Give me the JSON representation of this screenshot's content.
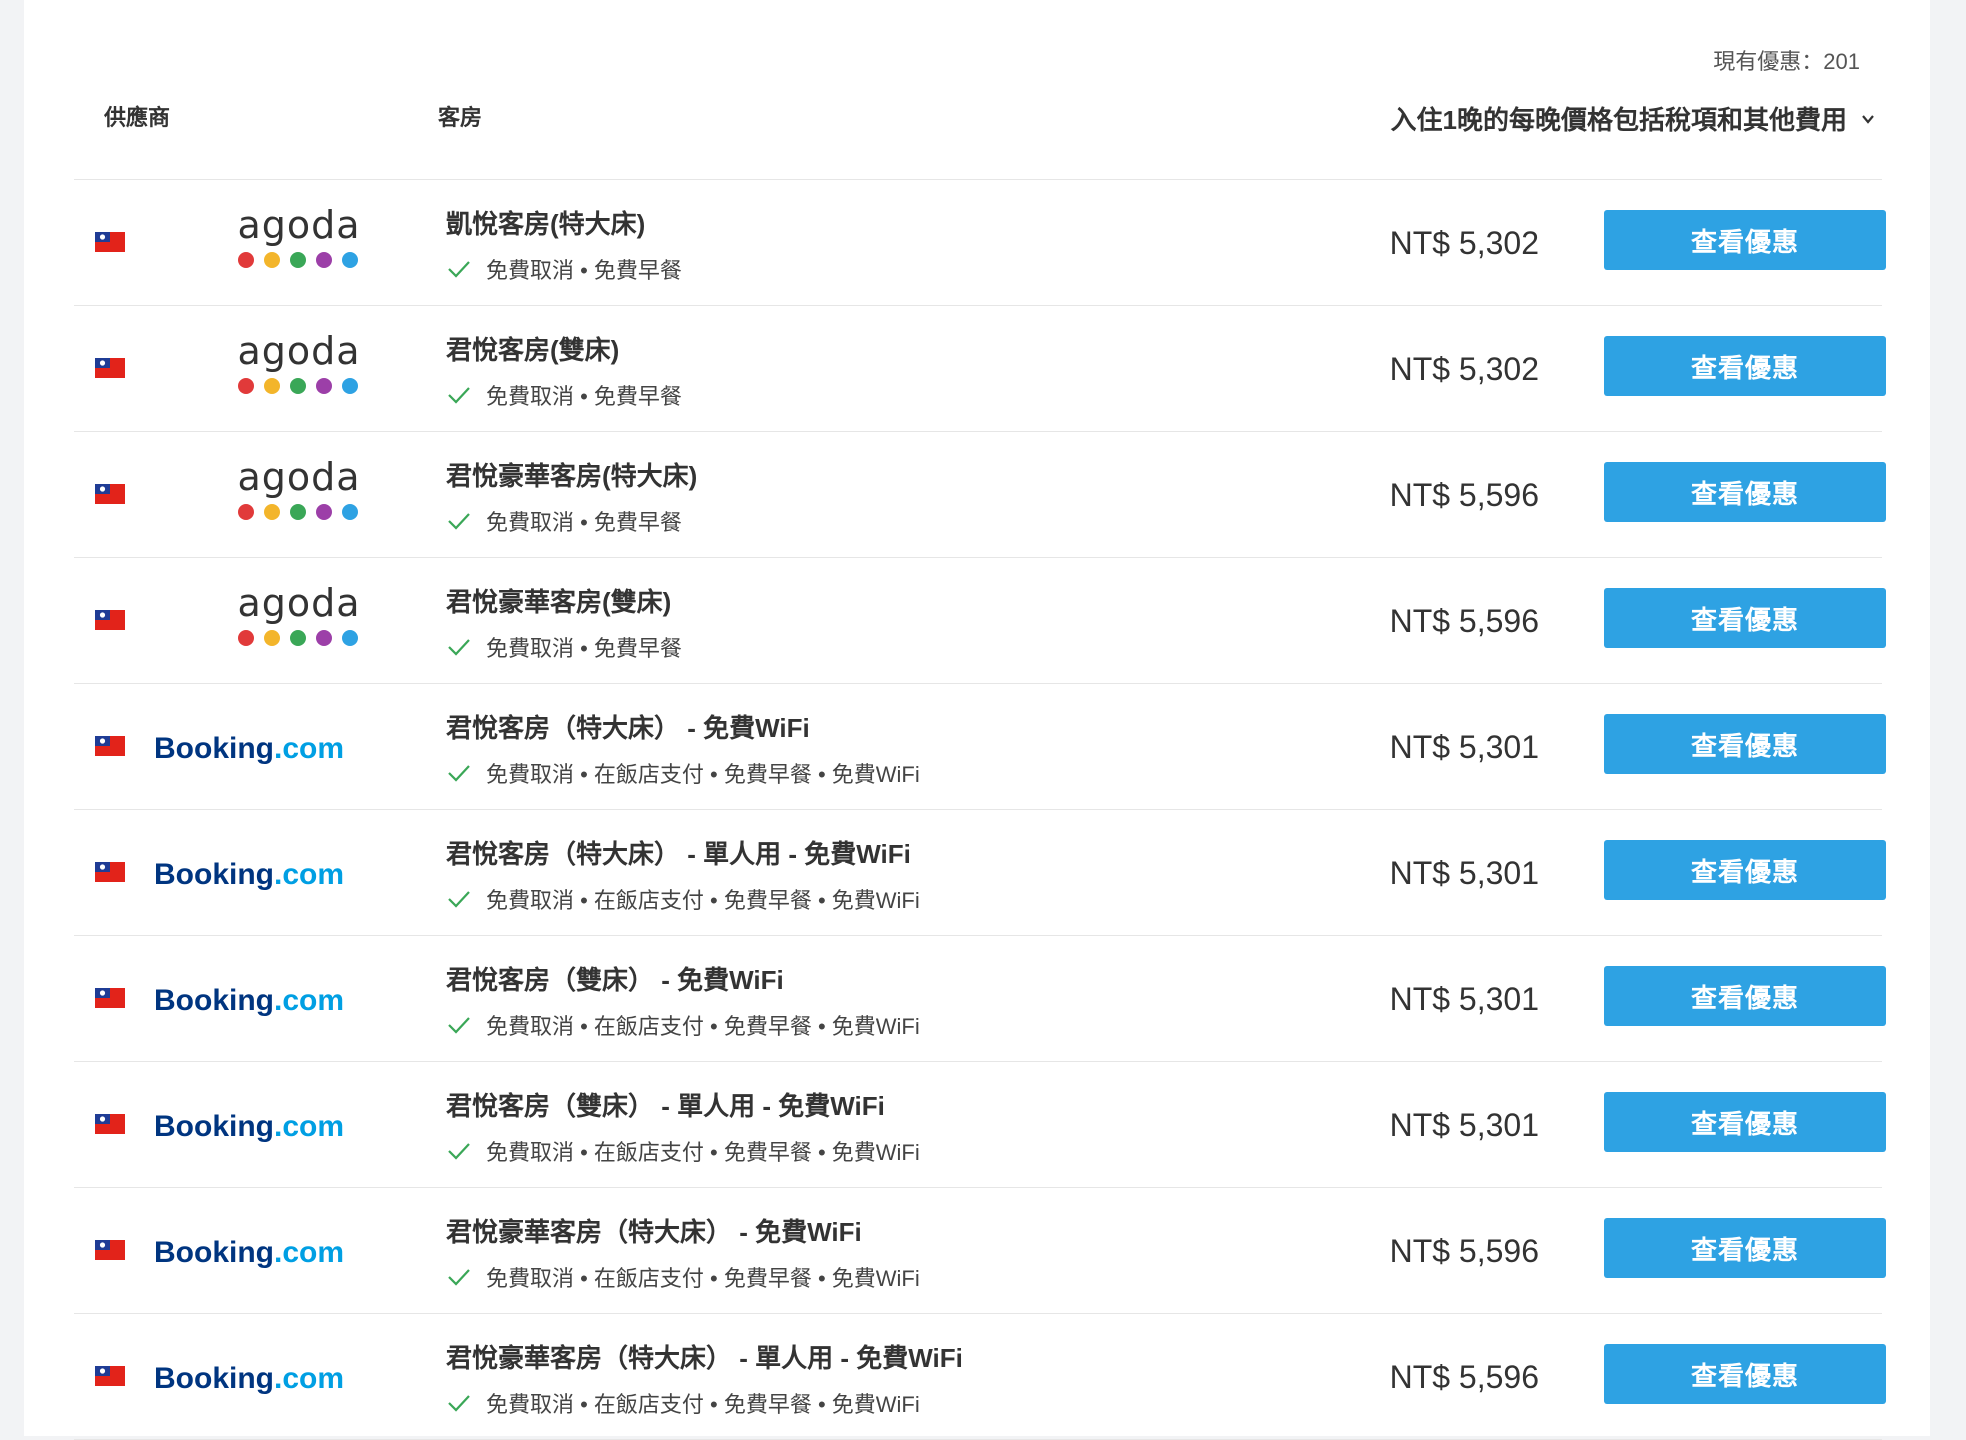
{
  "offers_count_label": "現有優惠：201",
  "headers": {
    "provider": "供應商",
    "room": "客房",
    "price": "入住1晚的每晚價格包括稅項和其他費用"
  },
  "colors": {
    "button": "#2ea2e3",
    "check": "#3aa757",
    "booking_dark": "#003580",
    "booking_light": "#009fe3",
    "agoda_dots": [
      "#e13a3a",
      "#f3b52b",
      "#3aa757",
      "#9c3fa8",
      "#2ea2e3"
    ]
  },
  "rows": [
    {
      "provider": "agoda",
      "provider_text": "agoda",
      "title": "凱悅客房(特大床)",
      "features": "免費取消 • 免費早餐",
      "price": "NT$ 5,302",
      "button": "查看優惠"
    },
    {
      "provider": "agoda",
      "provider_text": "agoda",
      "title": "君悅客房(雙床)",
      "features": "免費取消 • 免費早餐",
      "price": "NT$ 5,302",
      "button": "查看優惠"
    },
    {
      "provider": "agoda",
      "provider_text": "agoda",
      "title": "君悅豪華客房(特大床)",
      "features": "免費取消 • 免費早餐",
      "price": "NT$ 5,596",
      "button": "查看優惠"
    },
    {
      "provider": "agoda",
      "provider_text": "agoda",
      "title": "君悅豪華客房(雙床)",
      "features": "免費取消 • 免費早餐",
      "price": "NT$ 5,596",
      "button": "查看優惠"
    },
    {
      "provider": "booking",
      "provider_text": "Booking.com",
      "title": "君悅客房（特大床） - 免費WiFi",
      "features": "免費取消 • 在飯店支付 • 免費早餐 • 免費WiFi",
      "price": "NT$ 5,301",
      "button": "查看優惠"
    },
    {
      "provider": "booking",
      "provider_text": "Booking.com",
      "title": "君悅客房（特大床） - 單人用 - 免費WiFi",
      "features": "免費取消 • 在飯店支付 • 免費早餐 • 免費WiFi",
      "price": "NT$ 5,301",
      "button": "查看優惠"
    },
    {
      "provider": "booking",
      "provider_text": "Booking.com",
      "title": "君悅客房（雙床） - 免費WiFi",
      "features": "免費取消 • 在飯店支付 • 免費早餐 • 免費WiFi",
      "price": "NT$ 5,301",
      "button": "查看優惠"
    },
    {
      "provider": "booking",
      "provider_text": "Booking.com",
      "title": "君悅客房（雙床） - 單人用 - 免費WiFi",
      "features": "免費取消 • 在飯店支付 • 免費早餐 • 免費WiFi",
      "price": "NT$ 5,301",
      "button": "查看優惠"
    },
    {
      "provider": "booking",
      "provider_text": "Booking.com",
      "title": "君悅豪華客房（特大床） - 免費WiFi",
      "features": "免費取消 • 在飯店支付 • 免費早餐 • 免費WiFi",
      "price": "NT$ 5,596",
      "button": "查看優惠"
    },
    {
      "provider": "booking",
      "provider_text": "Booking.com",
      "title": "君悅豪華客房（特大床） - 單人用 - 免費WiFi",
      "features": "免費取消 • 在飯店支付 • 免費早餐 • 免費WiFi",
      "price": "NT$ 5,596",
      "button": "查看優惠"
    }
  ]
}
